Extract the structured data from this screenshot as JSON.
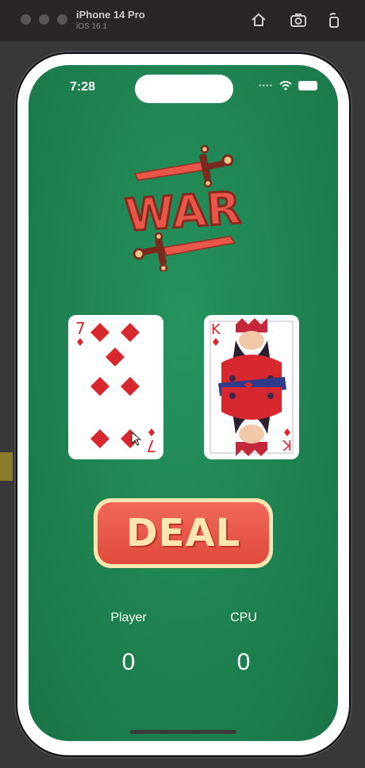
{
  "simulator": {
    "device_name": "iPhone 14 Pro",
    "os_version": "iOS 16.1"
  },
  "status_bar": {
    "time": "7:28"
  },
  "logo": {
    "text": "WAR",
    "colors": {
      "blade": "#e8574a",
      "hilt": "#7a2b1e",
      "text_fill": "#e8574a",
      "text_outline": "#8a2a1e"
    }
  },
  "cards": {
    "player": {
      "rank": "7",
      "suit": "diamonds",
      "suit_color": "#d7282f"
    },
    "cpu": {
      "rank": "K",
      "suit": "diamonds",
      "suit_color": "#d7282f"
    }
  },
  "deal_button": {
    "label": "DEAL"
  },
  "scores": {
    "player_label": "Player",
    "player_value": "0",
    "cpu_label": "CPU",
    "cpu_value": "0"
  },
  "colors": {
    "table_green": "#1f8553",
    "deal_red": "#e8574a",
    "deal_cream": "#fbe6b2"
  }
}
